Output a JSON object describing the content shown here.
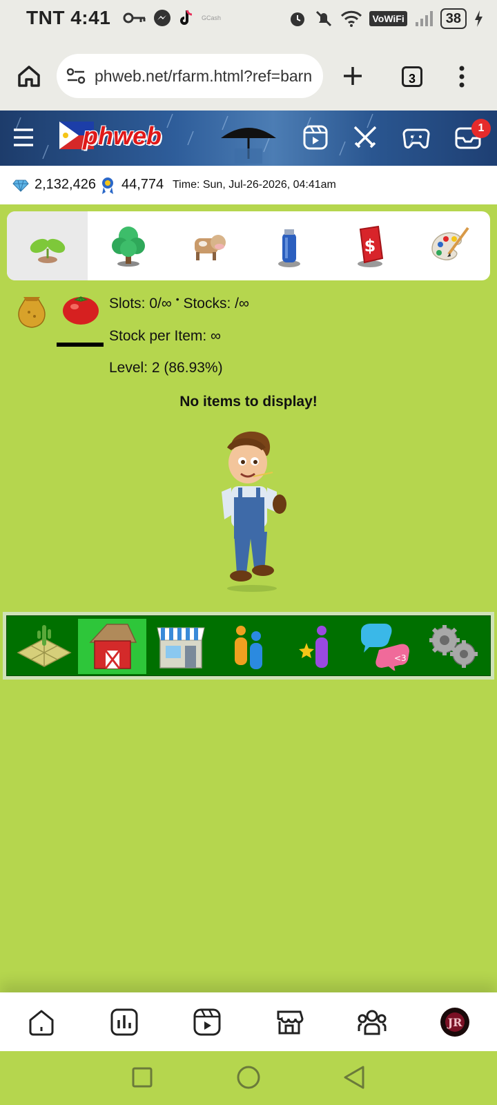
{
  "status_bar": {
    "carrier": "TNT",
    "time": "4:41",
    "tiny_text": "GCash",
    "vowifi": "VoWiFi",
    "battery": "38"
  },
  "browser": {
    "url": "phweb.net/rfarm.html?ref=barn",
    "tab_count": "3"
  },
  "site_header": {
    "logo": "phweb",
    "notification_count": "1"
  },
  "stats": {
    "diamonds": "2,132,426",
    "medals": "44,774",
    "time": "Time: Sun, Jul-26-2026, 04:41am"
  },
  "category_tabs": [
    {
      "icon": "sprout-icon"
    },
    {
      "icon": "tree-icon"
    },
    {
      "icon": "cow-icon"
    },
    {
      "icon": "spray-can-icon"
    },
    {
      "icon": "dollar-tag-icon"
    },
    {
      "icon": "paint-palette-icon"
    }
  ],
  "info": {
    "slots": "Slots: 0/∞",
    "stocks": "Stocks: /∞",
    "stock_per_item": "Stock per Item: ∞",
    "level": "Level: 2 (86.93%)",
    "no_items": "No items to display!"
  },
  "game_menu": [
    {
      "icon": "farm-plot-icon"
    },
    {
      "icon": "barn-icon"
    },
    {
      "icon": "shop-icon"
    },
    {
      "icon": "neighbors-icon"
    },
    {
      "icon": "achievement-person-icon"
    },
    {
      "icon": "chat-bubbles-icon"
    },
    {
      "icon": "settings-gears-icon"
    }
  ],
  "colors": {
    "page_bg": "#b5d64e",
    "menu_green": "#007000",
    "menu_active": "#2ec63a",
    "badge_red": "#e52b2b"
  }
}
